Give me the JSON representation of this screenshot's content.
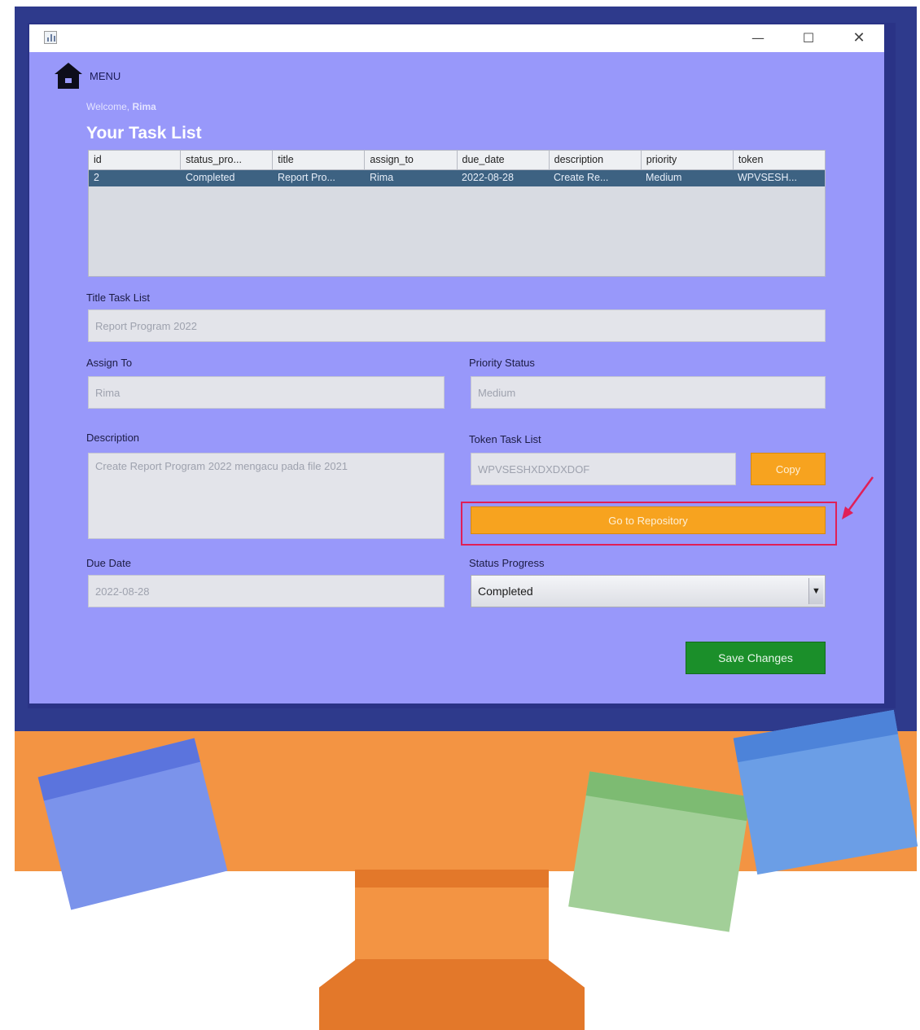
{
  "window": {
    "minimize_glyph": "—",
    "maximize_glyph": "☐",
    "close_glyph": "✕"
  },
  "menu": {
    "label": "MENU",
    "icon": "home-icon"
  },
  "welcome": {
    "prefix": "Welcome,",
    "user": "Rima"
  },
  "page_title": "Your Task List",
  "table": {
    "columns": [
      "id",
      "status_pro...",
      "title",
      "assign_to",
      "due_date",
      "description",
      "priority",
      "token"
    ],
    "rows": [
      [
        "2",
        "Completed",
        "Report Pro...",
        "Rima",
        "2022-08-28",
        "Create Re...",
        "Medium",
        "WPVSESH..."
      ]
    ]
  },
  "form": {
    "title_label": "Title Task List",
    "title_value": "Report Program 2022",
    "assign_label": "Assign To",
    "assign_value": "Rima",
    "priority_label": "Priority Status",
    "priority_value": "Medium",
    "description_label": "Description",
    "description_value": "Create Report Program 2022 mengacu pada file 2021",
    "token_label": "Token Task List",
    "token_value": "WPVSESHXDXDXDOF",
    "copy_label": "Copy",
    "repo_label": "Go to Repository",
    "due_label": "Due Date",
    "due_value": "2022-08-28",
    "status_label": "Status Progress",
    "status_value": "Completed",
    "save_label": "Save Changes"
  },
  "colors": {
    "window_bg": "#9898fa",
    "button_orange": "#f7a31f",
    "button_green": "#1b8f2a",
    "highlight": "#e01f57",
    "selected_row": "#3d6282",
    "monitor_bezel": "#2e3a8c",
    "monitor_stand": "#f39443"
  }
}
